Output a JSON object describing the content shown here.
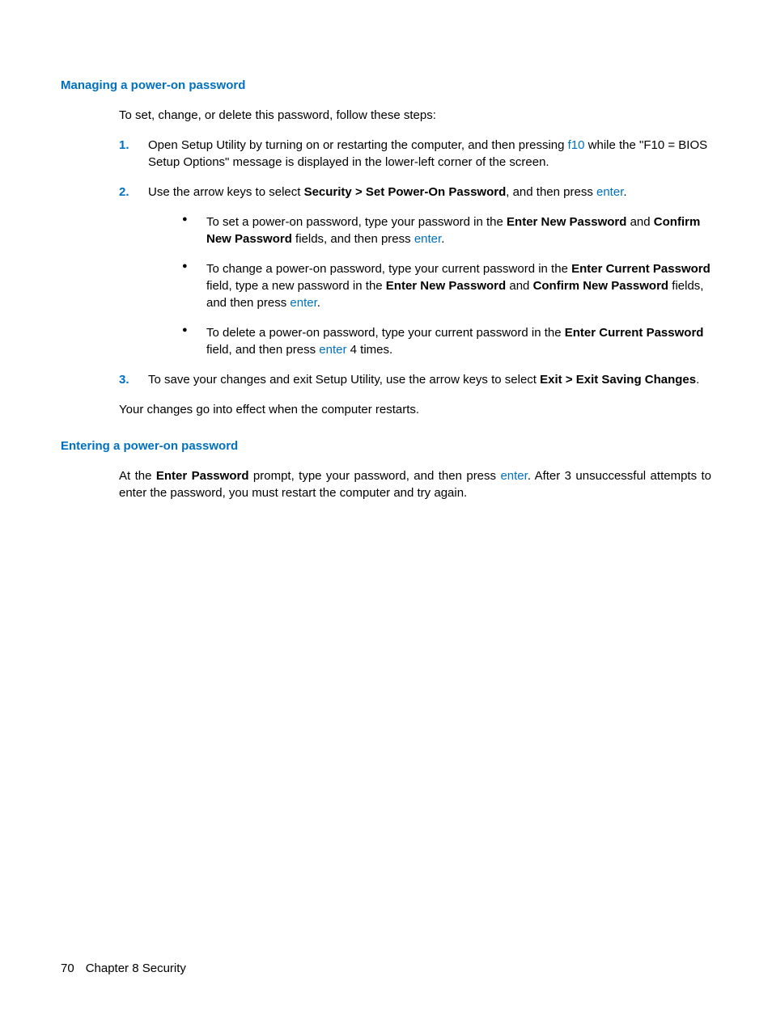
{
  "section1": {
    "heading": "Managing a power-on password",
    "intro": "To set, change, or delete this password, follow these steps:",
    "step1": {
      "num": "1.",
      "part1": "Open Setup Utility by turning on or restarting the computer, and then pressing ",
      "key": "f10",
      "part2": " while the \"F10 = BIOS Setup Options\" message is displayed in the lower-left corner of the screen."
    },
    "step2": {
      "num": "2.",
      "part1": "Use the arrow keys to select ",
      "bold1": "Security > Set Power-On Password",
      "part2": ", and then press ",
      "key": "enter",
      "part3": ".",
      "bullets": {
        "b1": {
          "part1": "To set a power-on password, type your password in the ",
          "bold1": "Enter New Password",
          "part2": " and ",
          "bold2": "Confirm New Password",
          "part3": " fields, and then press ",
          "key": "enter",
          "part4": "."
        },
        "b2": {
          "part1": "To change a power-on password, type your current password in the ",
          "bold1": "Enter Current Password",
          "part2": " field, type a new password in the ",
          "bold2": "Enter New Password",
          "part3": " and ",
          "bold3": "Confirm New Password",
          "part4": " fields, and then press ",
          "key": "enter",
          "part5": "."
        },
        "b3": {
          "part1": "To delete a power-on password, type your current password in the ",
          "bold1": "Enter Current Password",
          "part2": " field, and then press ",
          "key": "enter",
          "part3": " 4 times."
        }
      }
    },
    "step3": {
      "num": "3.",
      "part1": "To save your changes and exit Setup Utility, use the arrow keys to select ",
      "bold1": "Exit > Exit Saving Changes",
      "part2": "."
    },
    "outro": "Your changes go into effect when the computer restarts."
  },
  "section2": {
    "heading": "Entering a power-on password",
    "para": {
      "part1": "At the ",
      "bold1": "Enter Password",
      "part2": " prompt, type your password, and then press ",
      "key": "enter",
      "part3": ". After 3 unsuccessful attempts to enter the password, you must restart the computer and try again."
    }
  },
  "footer": {
    "pagenum": "70",
    "chapter": "Chapter 8   Security"
  }
}
